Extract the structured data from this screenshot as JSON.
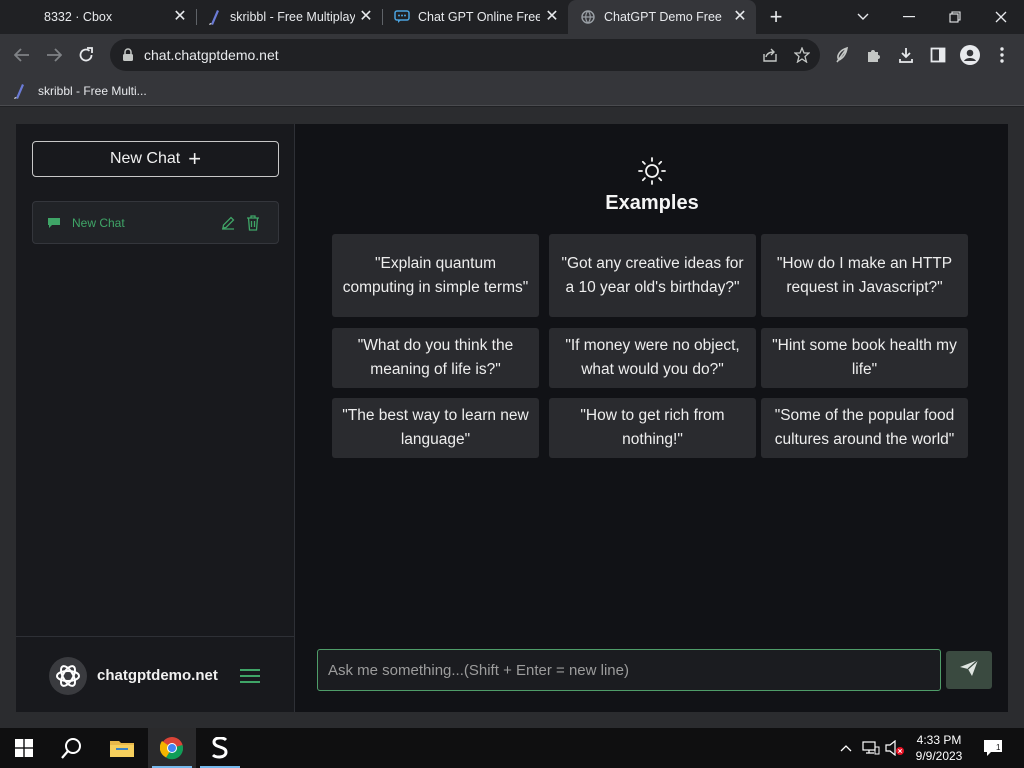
{
  "browser": {
    "tabs": [
      {
        "title": "8332 · Cbox",
        "favicon": "none"
      },
      {
        "title": "skribbl - Free Multiplay",
        "favicon": "skribbl-icon"
      },
      {
        "title": "Chat GPT Online Free -",
        "favicon": "chat-icon"
      },
      {
        "title": "ChatGPT Demo Free",
        "favicon": "globe-icon",
        "active": true
      }
    ],
    "address": "chat.chatgptdemo.net",
    "bookmarks": [
      {
        "label": "skribbl - Free Multi...",
        "favicon": "skribbl-icon"
      }
    ]
  },
  "app": {
    "sidebar": {
      "new_chat_label": "New Chat",
      "chats": [
        {
          "label": "New Chat"
        }
      ],
      "brand_name": "chatgptdemo.net"
    },
    "main": {
      "examples_title": "Examples",
      "examples": [
        "\"Explain quantum computing in simple terms\"",
        "\"Got any creative ideas for a 10 year old's birthday?\"",
        "\"How do I make an HTTP request in Javascript?\"",
        "\"What do you think the meaning of life is?\"",
        "\"If money were no object, what would you do?\"",
        "\"Hint some book health my life\"",
        "\"The best way to learn new language\"",
        "\"How to get rich from nothing!\"",
        "\"Some of the popular food cultures around the world\""
      ],
      "input_placeholder": "Ask me something...(Shift + Enter = new line)"
    },
    "colors": {
      "accent_green": "#3fa567",
      "background": "#111216"
    }
  },
  "taskbar": {
    "time": "4:33 PM",
    "date": "9/9/2023"
  }
}
